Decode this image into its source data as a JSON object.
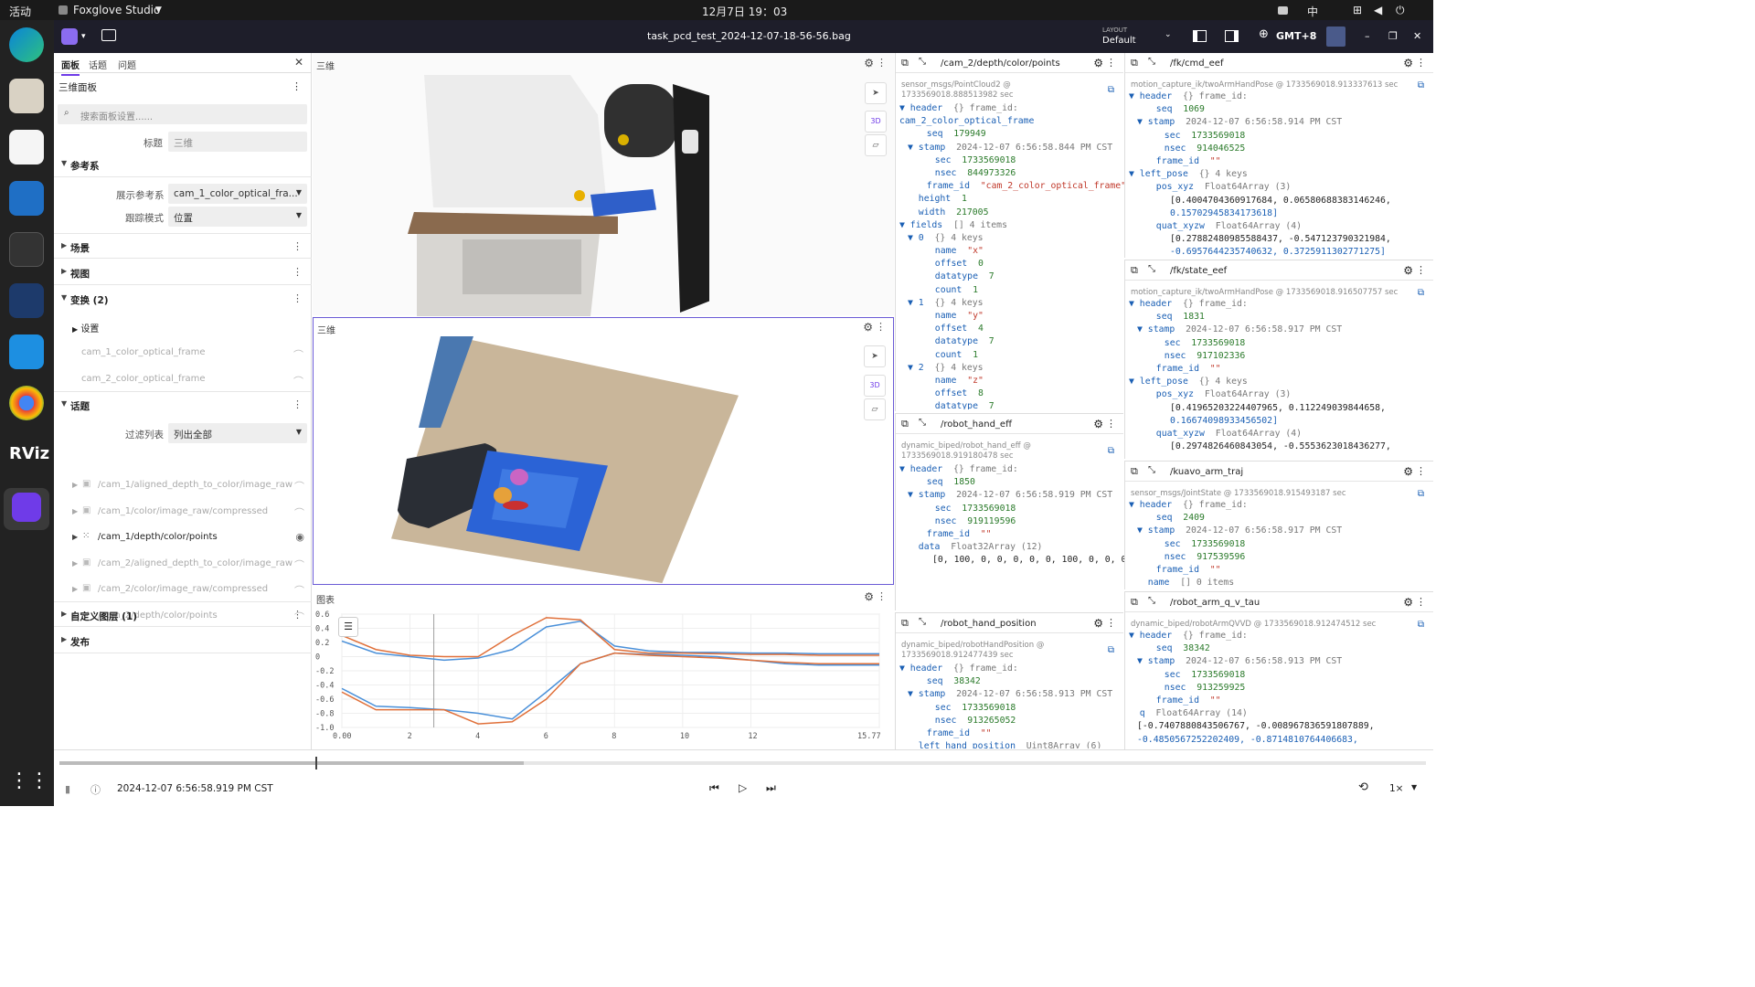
{
  "system": {
    "activities": "活动",
    "app_menu": "Foxglove Studio",
    "clock": "12月7日 19：03",
    "ime": "中"
  },
  "titlebar": {
    "file": "task_pcd_test_2024-12-07-18-56-56.bag",
    "layout_label": "LAYOUT",
    "layout_value": "Default",
    "timezone": "GMT+8"
  },
  "left": {
    "tabs": [
      "面板",
      "话题",
      "问题"
    ],
    "panel_name": "三维面板",
    "search_placeholder": "搜索面板设置......",
    "title_label": "标题",
    "title_value": "三维",
    "ref_section": "参考系",
    "display_frame_label": "展示参考系",
    "display_frame_value": "cam_1_color_optical_fra...",
    "follow_label": "跟踪模式",
    "follow_value": "位置",
    "scene": "场景",
    "view": "视图",
    "transforms": "变换 (2)",
    "settings": "设置",
    "frames": [
      "cam_1_color_optical_frame",
      "cam_2_color_optical_frame"
    ],
    "topics_section": "话题",
    "filter_label": "过滤列表",
    "filter_value": "列出全部",
    "topics": [
      "/cam_1/aligned_depth_to_color/image_raw",
      "/cam_1/color/image_raw/compressed",
      "/cam_1/depth/color/points",
      "/cam_2/aligned_depth_to_color/image_raw",
      "/cam_2/color/image_raw/compressed",
      "/cam_2/depth/color/points"
    ],
    "custom_layers": "自定义图层 (1)",
    "publish": "发布"
  },
  "view1": {
    "title": "三维",
    "badge": "3D"
  },
  "view2": {
    "title": "三维",
    "badge": "3D"
  },
  "plot": {
    "title": "图表"
  },
  "chart_data": {
    "type": "line",
    "yticks": [
      "0.6",
      "0.4",
      "0.2",
      "0",
      "-0.2",
      "-0.4",
      "-0.6",
      "-0.8",
      "-1.0"
    ],
    "xticks": [
      "0.00",
      "2",
      "4",
      "6",
      "8",
      "10",
      "12",
      "15.77"
    ],
    "ylim": [
      -1.0,
      0.6
    ],
    "xlim": [
      0,
      15.77
    ],
    "series": [
      {
        "color": "#4a90d9",
        "x": [
          0,
          1,
          2,
          3,
          4,
          5,
          6,
          7,
          8,
          9,
          10,
          11,
          12,
          13,
          14,
          15.77
        ],
        "y": [
          0.22,
          0.05,
          0.0,
          -0.05,
          -0.02,
          0.1,
          0.42,
          0.5,
          0.15,
          0.08,
          0.06,
          0.06,
          0.05,
          0.05,
          0.04,
          0.04
        ]
      },
      {
        "color": "#e0703a",
        "x": [
          0,
          1,
          2,
          3,
          4,
          5,
          6,
          7,
          8,
          9,
          10,
          11,
          12,
          13,
          14,
          15.77
        ],
        "y": [
          0.3,
          0.1,
          0.02,
          0.0,
          0.0,
          0.3,
          0.55,
          0.52,
          0.1,
          0.05,
          0.05,
          0.04,
          0.03,
          0.03,
          0.02,
          0.02
        ]
      },
      {
        "color": "#4a90d9",
        "x": [
          0,
          1,
          2,
          3,
          4,
          5,
          6,
          7,
          8,
          9,
          10,
          11,
          12,
          13,
          14,
          15.77
        ],
        "y": [
          -0.45,
          -0.7,
          -0.72,
          -0.75,
          -0.8,
          -0.88,
          -0.5,
          -0.1,
          0.05,
          0.03,
          0.02,
          0.0,
          -0.05,
          -0.1,
          -0.12,
          -0.12
        ]
      },
      {
        "color": "#e0703a",
        "x": [
          0,
          1,
          2,
          3,
          4,
          5,
          6,
          7,
          8,
          9,
          10,
          11,
          12,
          13,
          14,
          15.77
        ],
        "y": [
          -0.5,
          -0.75,
          -0.75,
          -0.75,
          -0.95,
          -0.92,
          -0.6,
          -0.1,
          0.05,
          0.02,
          0.0,
          -0.02,
          -0.05,
          -0.08,
          -0.1,
          -0.1
        ]
      }
    ]
  },
  "raw1": {
    "topic": "/cam_2/depth/color/points",
    "meta1": "sensor_msgs/PointCloud2 @",
    "meta2": "1733569018.888513982 sec",
    "lines": [
      {
        "i": 0,
        "a": "▼",
        "k": "header",
        "g": "{} frame_id:"
      },
      {
        "i": 0,
        "a": "",
        "k": "",
        "v": "cam_2_color_optical_frame",
        "raw": true
      },
      {
        "i": 2,
        "a": "",
        "k": "seq",
        "v": "179949"
      },
      {
        "i": 1,
        "a": "▼",
        "k": "stamp",
        "g": "2024-12-07 6:56:58.844 PM CST"
      },
      {
        "i": 3,
        "a": "",
        "k": "sec",
        "v": "1733569018"
      },
      {
        "i": 3,
        "a": "",
        "k": "nsec",
        "v": "844973326"
      },
      {
        "i": 2,
        "a": "",
        "k": "frame_id",
        "s": "\"cam_2_color_optical_frame\""
      },
      {
        "i": 1,
        "a": "",
        "k": "height",
        "v": "1"
      },
      {
        "i": 1,
        "a": "",
        "k": "width",
        "v": "217005"
      },
      {
        "i": 0,
        "a": "▼",
        "k": "fields",
        "g": "[] 4 items"
      },
      {
        "i": 1,
        "a": "▼",
        "k": "0",
        "g": "{} 4 keys"
      },
      {
        "i": 3,
        "a": "",
        "k": "name",
        "s": "\"x\""
      },
      {
        "i": 3,
        "a": "",
        "k": "offset",
        "v": "0"
      },
      {
        "i": 3,
        "a": "",
        "k": "datatype",
        "v": "7"
      },
      {
        "i": 3,
        "a": "",
        "k": "count",
        "v": "1"
      },
      {
        "i": 1,
        "a": "▼",
        "k": "1",
        "g": "{} 4 keys"
      },
      {
        "i": 3,
        "a": "",
        "k": "name",
        "s": "\"y\""
      },
      {
        "i": 3,
        "a": "",
        "k": "offset",
        "v": "4"
      },
      {
        "i": 3,
        "a": "",
        "k": "datatype",
        "v": "7"
      },
      {
        "i": 3,
        "a": "",
        "k": "count",
        "v": "1"
      },
      {
        "i": 1,
        "a": "▼",
        "k": "2",
        "g": "{} 4 keys"
      },
      {
        "i": 3,
        "a": "",
        "k": "name",
        "s": "\"z\""
      },
      {
        "i": 3,
        "a": "",
        "k": "offset",
        "v": "8"
      },
      {
        "i": 3,
        "a": "",
        "k": "datatype",
        "v": "7"
      }
    ]
  },
  "raw2": {
    "topic": "/robot_hand_eff",
    "meta1": "dynamic_biped/robot_hand_eff @",
    "meta2": "1733569018.919180478 sec",
    "lines": [
      {
        "i": 0,
        "a": "▼",
        "k": "header",
        "g": "{} frame_id:"
      },
      {
        "i": 2,
        "a": "",
        "k": "seq",
        "v": "1850"
      },
      {
        "i": 1,
        "a": "▼",
        "k": "stamp",
        "g": "2024-12-07 6:56:58.919 PM CST"
      },
      {
        "i": 3,
        "a": "",
        "k": "sec",
        "v": "1733569018"
      },
      {
        "i": 3,
        "a": "",
        "k": "nsec",
        "v": "919119596"
      },
      {
        "i": 2,
        "a": "",
        "k": "frame_id",
        "s": "\"\""
      },
      {
        "i": 1,
        "a": "",
        "k": "data",
        "g": "Float32Array (12)"
      },
      {
        "i": 4,
        "a": "",
        "k": "",
        "v": "[0, 100, 0, 0, 0, 0, 0, 100, 0, 0, 0, 0]",
        "raw": true
      }
    ]
  },
  "raw3": {
    "topic": "/robot_hand_position",
    "meta1": "dynamic_biped/robotHandPosition @",
    "meta2": "1733569018.912477439 sec",
    "lines": [
      {
        "i": 0,
        "a": "▼",
        "k": "header",
        "g": "{} frame_id:"
      },
      {
        "i": 2,
        "a": "",
        "k": "seq",
        "v": "38342"
      },
      {
        "i": 1,
        "a": "▼",
        "k": "stamp",
        "g": "2024-12-07 6:56:58.913 PM CST"
      },
      {
        "i": 3,
        "a": "",
        "k": "sec",
        "v": "1733569018"
      },
      {
        "i": 3,
        "a": "",
        "k": "nsec",
        "v": "913265052"
      },
      {
        "i": 2,
        "a": "",
        "k": "frame_id",
        "s": "\"\""
      },
      {
        "i": 1,
        "a": "",
        "k": "left_hand_position",
        "g": "Uint8Array (6)"
      }
    ]
  },
  "raw4": {
    "topic": "/fk/cmd_eef",
    "meta1": "motion_capture_ik/twoArmHandPose @ 1733569018.913337613 sec",
    "lines": [
      {
        "i": 0,
        "a": "▼",
        "k": "header",
        "g": "{} frame_id:"
      },
      {
        "i": 2,
        "a": "",
        "k": "seq",
        "v": "1069"
      },
      {
        "i": 1,
        "a": "▼",
        "k": "stamp",
        "g": "2024-12-07 6:56:58.914 PM CST"
      },
      {
        "i": 3,
        "a": "",
        "k": "sec",
        "v": "1733569018"
      },
      {
        "i": 3,
        "a": "",
        "k": "nsec",
        "v": "914046525"
      },
      {
        "i": 2,
        "a": "",
        "k": "frame_id",
        "s": "\"\""
      },
      {
        "i": 0,
        "a": "▼",
        "k": "left_pose",
        "g": "{} 4 keys"
      },
      {
        "i": 2,
        "a": "",
        "k": "pos_xyz",
        "g": "Float64Array (3)"
      },
      {
        "i": 5,
        "a": "",
        "k": "",
        "v": "[0.4004704360917684, 0.06580688383146246,",
        "raw": true
      },
      {
        "i": 5,
        "a": "",
        "k": "",
        "v": "0.15702945834173618]",
        "raw": true
      },
      {
        "i": 2,
        "a": "",
        "k": "quat_xyzw",
        "g": "Float64Array (4)"
      },
      {
        "i": 5,
        "a": "",
        "k": "",
        "v": "[0.27882480985588437, -0.547123790321984,",
        "raw": true
      },
      {
        "i": 5,
        "a": "",
        "k": "",
        "v": "-0.6957644235740632, 0.3725911302771275]",
        "raw": true
      }
    ]
  },
  "raw5": {
    "topic": "/fk/state_eef",
    "meta1": "motion_capture_ik/twoArmHandPose @ 1733569018.916507757 sec",
    "lines": [
      {
        "i": 0,
        "a": "▼",
        "k": "header",
        "g": "{} frame_id:"
      },
      {
        "i": 2,
        "a": "",
        "k": "seq",
        "v": "1831"
      },
      {
        "i": 1,
        "a": "▼",
        "k": "stamp",
        "g": "2024-12-07 6:56:58.917 PM CST"
      },
      {
        "i": 3,
        "a": "",
        "k": "sec",
        "v": "1733569018"
      },
      {
        "i": 3,
        "a": "",
        "k": "nsec",
        "v": "917102336"
      },
      {
        "i": 2,
        "a": "",
        "k": "frame_id",
        "s": "\"\""
      },
      {
        "i": 0,
        "a": "▼",
        "k": "left_pose",
        "g": "{} 4 keys"
      },
      {
        "i": 2,
        "a": "",
        "k": "pos_xyz",
        "g": "Float64Array (3)"
      },
      {
        "i": 5,
        "a": "",
        "k": "",
        "v": "[0.41965203224407965, 0.112249039844658,",
        "raw": true
      },
      {
        "i": 5,
        "a": "",
        "k": "",
        "v": "0.16674098933456502]",
        "raw": true
      },
      {
        "i": 2,
        "a": "",
        "k": "quat_xyzw",
        "g": "Float64Array (4)"
      },
      {
        "i": 5,
        "a": "",
        "k": "",
        "v": "[0.2974826460843054, -0.5553623018436277,",
        "raw": true
      }
    ]
  },
  "raw6": {
    "topic": "/kuavo_arm_traj",
    "meta1": "sensor_msgs/JointState @ 1733569018.915493187 sec",
    "lines": [
      {
        "i": 0,
        "a": "▼",
        "k": "header",
        "g": "{} frame_id:"
      },
      {
        "i": 2,
        "a": "",
        "k": "seq",
        "v": "2409"
      },
      {
        "i": 1,
        "a": "▼",
        "k": "stamp",
        "g": "2024-12-07 6:56:58.917 PM CST"
      },
      {
        "i": 3,
        "a": "",
        "k": "sec",
        "v": "1733569018"
      },
      {
        "i": 3,
        "a": "",
        "k": "nsec",
        "v": "917539596"
      },
      {
        "i": 2,
        "a": "",
        "k": "frame_id",
        "s": "\"\""
      },
      {
        "i": 1,
        "a": "",
        "k": "name",
        "g": "[] 0 items"
      }
    ]
  },
  "raw7": {
    "topic": "/robot_arm_q_v_tau",
    "meta1": "dynamic_biped/robotArmQVVD @ 1733569018.912474512 sec",
    "lines": [
      {
        "i": 0,
        "a": "▼",
        "k": "header",
        "g": "{} frame_id:"
      },
      {
        "i": 2,
        "a": "",
        "k": "seq",
        "v": "38342"
      },
      {
        "i": 1,
        "a": "▼",
        "k": "stamp",
        "g": "2024-12-07 6:56:58.913 PM CST"
      },
      {
        "i": 3,
        "a": "",
        "k": "sec",
        "v": "1733569018"
      },
      {
        "i": 3,
        "a": "",
        "k": "nsec",
        "v": "913259925"
      },
      {
        "i": 2,
        "a": "",
        "k": "frame_id",
        "s": "\"\""
      },
      {
        "i": 0,
        "a": "",
        "k": "q",
        "g": "Float64Array (14)"
      },
      {
        "i": 1,
        "a": "",
        "k": "",
        "v": "[-0.7407880843506767, -0.008967836591807889,",
        "raw": true
      },
      {
        "i": 1,
        "a": "",
        "k": "",
        "v": "-0.4850567252202409, -0.8714810764406683,",
        "raw": true
      }
    ]
  },
  "playback": {
    "time": "2024-12-07 6:56:58.919 PM CST",
    "speed": "1×",
    "progress": 0.34
  },
  "colors": {
    "accent": "#6f3be8",
    "selection": "#6b5bd6",
    "topbar": "#1a1a1a",
    "dock": "#222222"
  }
}
